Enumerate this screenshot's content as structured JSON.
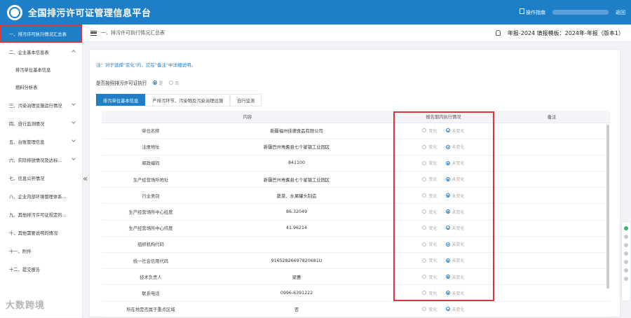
{
  "header": {
    "title": "全国排污许可证管理信息平台",
    "manual_label": "操作指南",
    "back_label": "返回"
  },
  "sidebar": {
    "items": [
      {
        "label": "一、排污许可执行情况汇总表",
        "active": true
      },
      {
        "label": "二、企业基本信息表",
        "expanded": true
      },
      {
        "label": "排污单位基本信息",
        "sub": true
      },
      {
        "label": "燃料分析表",
        "sub": true
      },
      {
        "label": "三、污染治理设施运行情况"
      },
      {
        "label": "四、自行监测情况"
      },
      {
        "label": "五、台账管理信息"
      },
      {
        "label": "六、实际排放情况及达标..."
      },
      {
        "label": "七、信息公开情况"
      },
      {
        "label": "八、企业内部环境管理体系..."
      },
      {
        "label": "九、其他排污许可证规定的..."
      },
      {
        "label": "十、其他需要说明的情况"
      },
      {
        "label": "十一、附件"
      },
      {
        "label": "十二、提交报告"
      }
    ],
    "watermark": "大数跨境"
  },
  "breadcrumb": {
    "text": "一、排污许可执行情况汇总表",
    "report_info": "年报-2024  填报模板：2024年-年报（版本1）"
  },
  "main": {
    "note": "注：对于选择\"变化\"的，应在\"备注\"中详细说明。",
    "question": "是否按照排污许可证执行",
    "question_options": [
      {
        "label": "是",
        "selected": true
      },
      {
        "label": "否",
        "selected": false
      }
    ],
    "tabs": [
      {
        "label": "排污单位基本信息",
        "active": true
      },
      {
        "label": "产排污环节、污染物及污染治理设施",
        "active": false
      },
      {
        "label": "自行监测",
        "active": false
      }
    ],
    "table": {
      "headers": [
        "内容",
        "",
        "报告期内执行情况",
        "备注"
      ],
      "option_changed": "变化",
      "option_unchanged": "未变化",
      "rows": [
        {
          "label": "单位名称",
          "value": "新疆福州佳德食品有限公司"
        },
        {
          "label": "注册地址",
          "value": "新疆巴州焉耆县七个星镇工业园区"
        },
        {
          "label": "邮政编码",
          "value": "841100"
        },
        {
          "label": "生产经营场所地址",
          "value": "新疆巴州焉耆县七个星镇工业园区"
        },
        {
          "label": "行业类别",
          "value": "蔬菜、水果罐头制造"
        },
        {
          "label": "生产经营场所中心经度",
          "value": "86.32049"
        },
        {
          "label": "生产经营场所中心纬度",
          "value": "41.96214"
        },
        {
          "label": "组织机构代码",
          "value": ""
        },
        {
          "label": "统一社会信用代码",
          "value": "91652826697820681U"
        },
        {
          "label": "技术负责人",
          "value": "梁蕙"
        },
        {
          "label": "联系电话",
          "value": "0996-6391222"
        },
        {
          "label": "所在地是否属于重点区域",
          "value": "否"
        }
      ]
    }
  }
}
